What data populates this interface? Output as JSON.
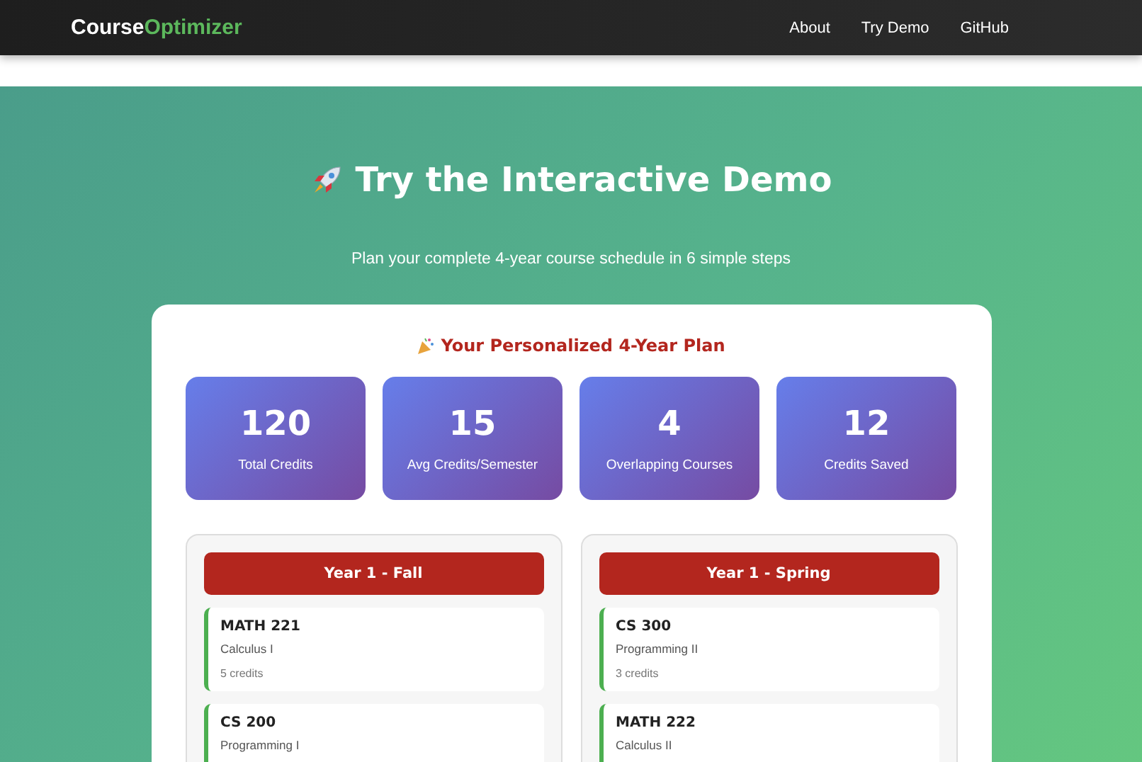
{
  "navbar": {
    "logo": {
      "first": "Course",
      "second": "Optimizer"
    },
    "links": [
      {
        "label": "About"
      },
      {
        "label": "Try Demo"
      },
      {
        "label": "GitHub"
      }
    ]
  },
  "hero": {
    "title": "Try the Interactive Demo",
    "subtitle": "Plan your complete 4-year course schedule in 6 simple steps"
  },
  "plan": {
    "title": "Your Personalized 4-Year Plan",
    "stats": [
      {
        "value": "120",
        "label": "Total Credits"
      },
      {
        "value": "15",
        "label": "Avg Credits/Semester"
      },
      {
        "value": "4",
        "label": "Overlapping Courses"
      },
      {
        "value": "12",
        "label": "Credits Saved"
      }
    ],
    "semesters": [
      {
        "title": "Year 1 - Fall",
        "courses": [
          {
            "code": "MATH 221",
            "name": "Calculus I",
            "credits": "5 credits"
          },
          {
            "code": "CS 200",
            "name": "Programming I"
          }
        ]
      },
      {
        "title": "Year 1 - Spring",
        "courses": [
          {
            "code": "CS 300",
            "name": "Programming II",
            "credits": "3 credits"
          },
          {
            "code": "MATH 222",
            "name": "Calculus II"
          }
        ]
      }
    ]
  }
}
